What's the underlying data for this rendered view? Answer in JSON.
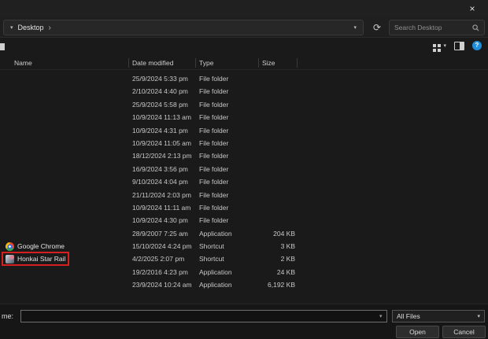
{
  "titlebar": {
    "close_glyph": "×"
  },
  "navbar": {
    "breadcrumb_chevron": "▾",
    "breadcrumb_root": "Desktop",
    "breadcrumb_sep": "›",
    "dropdown_chevron": "▾",
    "refresh_glyph": "⟳",
    "search_placeholder": "Search Desktop"
  },
  "toolbar": {
    "view_caret": "▾",
    "help_glyph": "?"
  },
  "list": {
    "columns": [
      "Name",
      "Date modified",
      "Type",
      "Size"
    ],
    "rows": [
      {
        "name": "",
        "icon": "",
        "date": "25/9/2024 5:33 pm",
        "type": "File folder",
        "size": "",
        "highlighted": false
      },
      {
        "name": "",
        "icon": "",
        "date": "2/10/2024 4:40 pm",
        "type": "File folder",
        "size": "",
        "highlighted": false
      },
      {
        "name": "",
        "icon": "",
        "date": "25/9/2024 5:58 pm",
        "type": "File folder",
        "size": "",
        "highlighted": false
      },
      {
        "name": "",
        "icon": "",
        "date": "10/9/2024 11:13 am",
        "type": "File folder",
        "size": "",
        "highlighted": false
      },
      {
        "name": "",
        "icon": "",
        "date": "10/9/2024 4:31 pm",
        "type": "File folder",
        "size": "",
        "highlighted": false
      },
      {
        "name": "",
        "icon": "",
        "date": "10/9/2024 11:05 am",
        "type": "File folder",
        "size": "",
        "highlighted": false
      },
      {
        "name": "",
        "icon": "",
        "date": "18/12/2024 2:13 pm",
        "type": "File folder",
        "size": "",
        "highlighted": false
      },
      {
        "name": "",
        "icon": "",
        "date": "16/9/2024 3:56 pm",
        "type": "File folder",
        "size": "",
        "highlighted": false
      },
      {
        "name": "",
        "icon": "",
        "date": "9/10/2024 4:04 pm",
        "type": "File folder",
        "size": "",
        "highlighted": false
      },
      {
        "name": "",
        "icon": "",
        "date": "21/11/2024 2:03 pm",
        "type": "File folder",
        "size": "",
        "highlighted": false
      },
      {
        "name": "",
        "icon": "",
        "date": "10/9/2024 11:11 am",
        "type": "File folder",
        "size": "",
        "highlighted": false
      },
      {
        "name": "",
        "icon": "",
        "date": "10/9/2024 4:30 pm",
        "type": "File folder",
        "size": "",
        "highlighted": false
      },
      {
        "name": "",
        "icon": "",
        "date": "28/9/2007 7:25 am",
        "type": "Application",
        "size": "204 KB",
        "highlighted": false
      },
      {
        "name": "Google Chrome",
        "icon": "chrome",
        "date": "15/10/2024 4:24 pm",
        "type": "Shortcut",
        "size": "3 KB",
        "highlighted": false
      },
      {
        "name": "Honkai Star Rail",
        "icon": "hsr",
        "date": "4/2/2025 2:07 pm",
        "type": "Shortcut",
        "size": "2 KB",
        "highlighted": true
      },
      {
        "name": "",
        "icon": "",
        "date": "19/2/2016 4:23 pm",
        "type": "Application",
        "size": "24 KB",
        "highlighted": false
      },
      {
        "name": "",
        "icon": "",
        "date": "23/9/2024 10:24 am",
        "type": "Application",
        "size": "6,192 KB",
        "highlighted": false
      }
    ]
  },
  "footer": {
    "filename_label": "me:",
    "filename_value": "",
    "input_caret": "▾",
    "filetype_value": "All Files",
    "filetype_caret": "▾",
    "open_label": "Open",
    "cancel_label": "Cancel"
  }
}
